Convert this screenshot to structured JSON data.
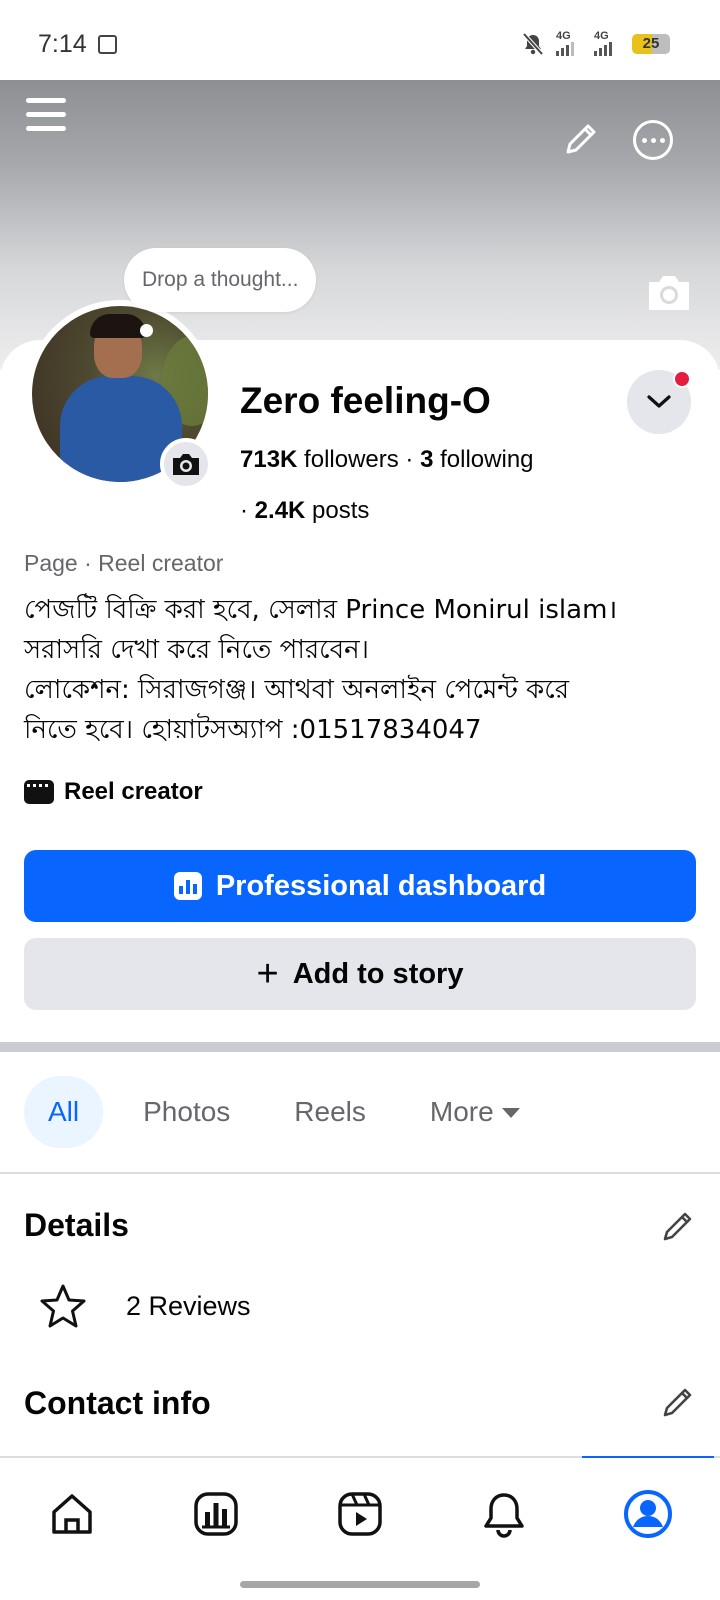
{
  "status_bar": {
    "time": "7:14",
    "network1": "4G",
    "network2": "4G",
    "battery": "25"
  },
  "cover": {
    "menu_icon": "hamburger-menu-icon",
    "edit_icon": "pencil-icon",
    "more_icon": "more-options-icon",
    "camera_icon": "camera-icon"
  },
  "profile": {
    "thought_placeholder": "Drop a thought...",
    "name": "Zero feeling-O",
    "followers_count": "713K",
    "followers_label": "followers",
    "separator": "·",
    "following_count": "3",
    "following_label": "following",
    "posts_count": "2.4K",
    "posts_label": "posts",
    "category": "Page · Reel creator",
    "bio_lines": [
      "পেজটি বিক্রি করা হবে, সেলার Prince Monirul islam।",
      "সরাসরি দেখা করে নিতে পারবেন।",
      "লোকেশন: সিরাজগঞ্জ। আথবা অনলাইন পেমেন্ট করে",
      "নিতে হবে। হোয়াটসঅ্যাপ :01517834047"
    ],
    "reel_creator_label": "Reel creator"
  },
  "buttons": {
    "professional_dashboard": "Professional dashboard",
    "add_to_story": "Add to story",
    "add_to_story_prefix": "+"
  },
  "tabs": [
    {
      "label": "All",
      "active": true
    },
    {
      "label": "Photos",
      "active": false
    },
    {
      "label": "Reels",
      "active": false
    },
    {
      "label": "More",
      "active": false
    }
  ],
  "details": {
    "title": "Details",
    "reviews": "2 Reviews"
  },
  "contact": {
    "title": "Contact info"
  },
  "bottom_nav": [
    {
      "icon": "home-icon"
    },
    {
      "icon": "dashboard-icon"
    },
    {
      "icon": "reels-icon"
    },
    {
      "icon": "bell-icon"
    },
    {
      "icon": "profile-icon",
      "active": true
    }
  ],
  "colors": {
    "accent": "#0866ff",
    "notification": "#e41e3f",
    "secondary_button": "#e4e6eb"
  }
}
